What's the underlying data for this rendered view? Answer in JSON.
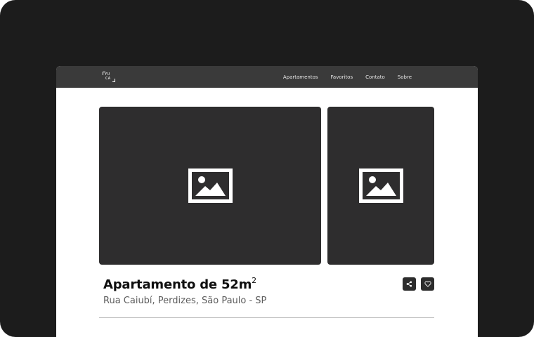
{
  "brand": {
    "logo_line1": "YU",
    "logo_line2": "CA"
  },
  "nav": {
    "links": [
      "Apartamentos",
      "Favoritos",
      "Contato",
      "Sobre"
    ]
  },
  "gallery": {
    "main_image_icon": "image-placeholder-icon",
    "side_image_icon": "image-placeholder-icon"
  },
  "listing": {
    "title": "Apartamento de 52m",
    "title_sup": "2",
    "address": "Rua Caiubí, Perdizes, São Paulo - SP"
  },
  "actions": {
    "share_icon": "share-icon",
    "favorite_icon": "heart-icon"
  },
  "colors": {
    "frame": "#1c1c1c",
    "navbar": "#3a3a3a",
    "photo_placeholder": "#2e2d2e",
    "button": "#2c2c2c"
  }
}
